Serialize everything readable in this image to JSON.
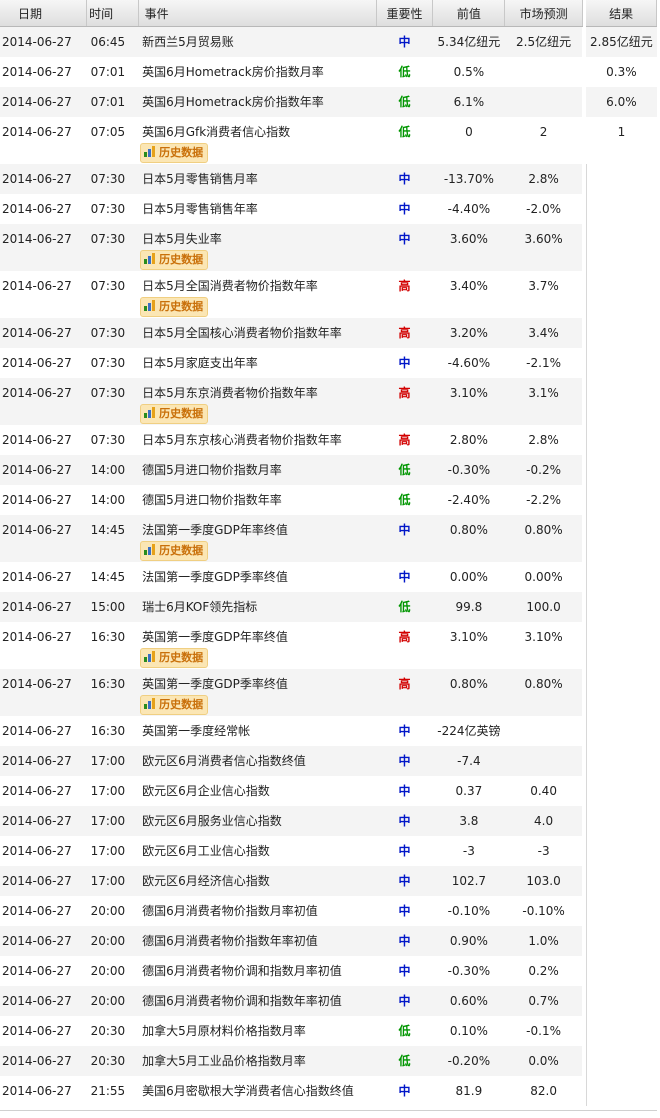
{
  "headers": {
    "date": "日期",
    "time": "时间",
    "event": "事件",
    "importance": "重要性",
    "previous": "前值",
    "forecast": "市场预测",
    "result": "结果"
  },
  "history_label": "历史数据",
  "colors": {
    "importance_high": "#d20000",
    "importance_mid": "#0016c8",
    "importance_low": "#009600"
  },
  "rows": [
    {
      "date": "2014-06-27",
      "time": "06:45",
      "event": "新西兰5月贸易账",
      "importance": "中",
      "previous": "5.34亿纽元",
      "forecast": "2.5亿纽元",
      "result": "2.85亿纽元",
      "history": false
    },
    {
      "date": "2014-06-27",
      "time": "07:01",
      "event": "英国6月Hometrack房价指数月率",
      "importance": "低",
      "previous": "0.5%",
      "forecast": "",
      "result": "0.3%",
      "history": false
    },
    {
      "date": "2014-06-27",
      "time": "07:01",
      "event": "英国6月Hometrack房价指数年率",
      "importance": "低",
      "previous": "6.1%",
      "forecast": "",
      "result": "6.0%",
      "history": false
    },
    {
      "date": "2014-06-27",
      "time": "07:05",
      "event": "英国6月Gfk消费者信心指数",
      "importance": "低",
      "previous": "0",
      "forecast": "2",
      "result": "1",
      "history": true
    },
    {
      "date": "2014-06-27",
      "time": "07:30",
      "event": "日本5月零售销售月率",
      "importance": "中",
      "previous": "-13.70%",
      "forecast": "2.8%",
      "result": "",
      "history": false
    },
    {
      "date": "2014-06-27",
      "time": "07:30",
      "event": "日本5月零售销售年率",
      "importance": "中",
      "previous": "-4.40%",
      "forecast": "-2.0%",
      "result": "",
      "history": false
    },
    {
      "date": "2014-06-27",
      "time": "07:30",
      "event": "日本5月失业率",
      "importance": "中",
      "previous": "3.60%",
      "forecast": "3.60%",
      "result": "",
      "history": true
    },
    {
      "date": "2014-06-27",
      "time": "07:30",
      "event": "日本5月全国消费者物价指数年率",
      "importance": "高",
      "previous": "3.40%",
      "forecast": "3.7%",
      "result": "",
      "history": true
    },
    {
      "date": "2014-06-27",
      "time": "07:30",
      "event": "日本5月全国核心消费者物价指数年率",
      "importance": "高",
      "previous": "3.20%",
      "forecast": "3.4%",
      "result": "",
      "history": false
    },
    {
      "date": "2014-06-27",
      "time": "07:30",
      "event": "日本5月家庭支出年率",
      "importance": "中",
      "previous": "-4.60%",
      "forecast": "-2.1%",
      "result": "",
      "history": false
    },
    {
      "date": "2014-06-27",
      "time": "07:30",
      "event": "日本5月东京消费者物价指数年率",
      "importance": "高",
      "previous": "3.10%",
      "forecast": "3.1%",
      "result": "",
      "history": true
    },
    {
      "date": "2014-06-27",
      "time": "07:30",
      "event": "日本5月东京核心消费者物价指数年率",
      "importance": "高",
      "previous": "2.80%",
      "forecast": "2.8%",
      "result": "",
      "history": false
    },
    {
      "date": "2014-06-27",
      "time": "14:00",
      "event": "德国5月进口物价指数月率",
      "importance": "低",
      "previous": "-0.30%",
      "forecast": "-0.2%",
      "result": "",
      "history": false
    },
    {
      "date": "2014-06-27",
      "time": "14:00",
      "event": "德国5月进口物价指数年率",
      "importance": "低",
      "previous": "-2.40%",
      "forecast": "-2.2%",
      "result": "",
      "history": false
    },
    {
      "date": "2014-06-27",
      "time": "14:45",
      "event": "法国第一季度GDP年率终值",
      "importance": "中",
      "previous": "0.80%",
      "forecast": "0.80%",
      "result": "",
      "history": true
    },
    {
      "date": "2014-06-27",
      "time": "14:45",
      "event": "法国第一季度GDP季率终值",
      "importance": "中",
      "previous": "0.00%",
      "forecast": "0.00%",
      "result": "",
      "history": false
    },
    {
      "date": "2014-06-27",
      "time": "15:00",
      "event": "瑞士6月KOF领先指标",
      "importance": "低",
      "previous": "99.8",
      "forecast": "100.0",
      "result": "",
      "history": false
    },
    {
      "date": "2014-06-27",
      "time": "16:30",
      "event": "英国第一季度GDP年率终值",
      "importance": "高",
      "previous": "3.10%",
      "forecast": "3.10%",
      "result": "",
      "history": true
    },
    {
      "date": "2014-06-27",
      "time": "16:30",
      "event": "英国第一季度GDP季率终值",
      "importance": "高",
      "previous": "0.80%",
      "forecast": "0.80%",
      "result": "",
      "history": true
    },
    {
      "date": "2014-06-27",
      "time": "16:30",
      "event": "英国第一季度经常帐",
      "importance": "中",
      "previous": "-224亿英镑",
      "forecast": "",
      "result": "",
      "history": false
    },
    {
      "date": "2014-06-27",
      "time": "17:00",
      "event": "欧元区6月消费者信心指数终值",
      "importance": "中",
      "previous": "-7.4",
      "forecast": "",
      "result": "",
      "history": false
    },
    {
      "date": "2014-06-27",
      "time": "17:00",
      "event": "欧元区6月企业信心指数",
      "importance": "中",
      "previous": "0.37",
      "forecast": "0.40",
      "result": "",
      "history": false
    },
    {
      "date": "2014-06-27",
      "time": "17:00",
      "event": "欧元区6月服务业信心指数",
      "importance": "中",
      "previous": "3.8",
      "forecast": "4.0",
      "result": "",
      "history": false
    },
    {
      "date": "2014-06-27",
      "time": "17:00",
      "event": "欧元区6月工业信心指数",
      "importance": "中",
      "previous": "-3",
      "forecast": "-3",
      "result": "",
      "history": false
    },
    {
      "date": "2014-06-27",
      "time": "17:00",
      "event": "欧元区6月经济信心指数",
      "importance": "中",
      "previous": "102.7",
      "forecast": "103.0",
      "result": "",
      "history": false
    },
    {
      "date": "2014-06-27",
      "time": "20:00",
      "event": "德国6月消费者物价指数月率初值",
      "importance": "中",
      "previous": "-0.10%",
      "forecast": "-0.10%",
      "result": "",
      "history": false
    },
    {
      "date": "2014-06-27",
      "time": "20:00",
      "event": "德国6月消费者物价指数年率初值",
      "importance": "中",
      "previous": "0.90%",
      "forecast": "1.0%",
      "result": "",
      "history": false
    },
    {
      "date": "2014-06-27",
      "time": "20:00",
      "event": "德国6月消费者物价调和指数月率初值",
      "importance": "中",
      "previous": "-0.30%",
      "forecast": "0.2%",
      "result": "",
      "history": false
    },
    {
      "date": "2014-06-27",
      "time": "20:00",
      "event": "德国6月消费者物价调和指数年率初值",
      "importance": "中",
      "previous": "0.60%",
      "forecast": "0.7%",
      "result": "",
      "history": false
    },
    {
      "date": "2014-06-27",
      "time": "20:30",
      "event": "加拿大5月原材料价格指数月率",
      "importance": "低",
      "previous": "0.10%",
      "forecast": "-0.1%",
      "result": "",
      "history": false
    },
    {
      "date": "2014-06-27",
      "time": "20:30",
      "event": "加拿大5月工业品价格指数月率",
      "importance": "低",
      "previous": "-0.20%",
      "forecast": "0.0%",
      "result": "",
      "history": false
    },
    {
      "date": "2014-06-27",
      "time": "21:55",
      "event": "美国6月密歇根大学消费者信心指数终值",
      "importance": "中",
      "previous": "81.9",
      "forecast": "82.0",
      "result": "",
      "history": false
    }
  ]
}
